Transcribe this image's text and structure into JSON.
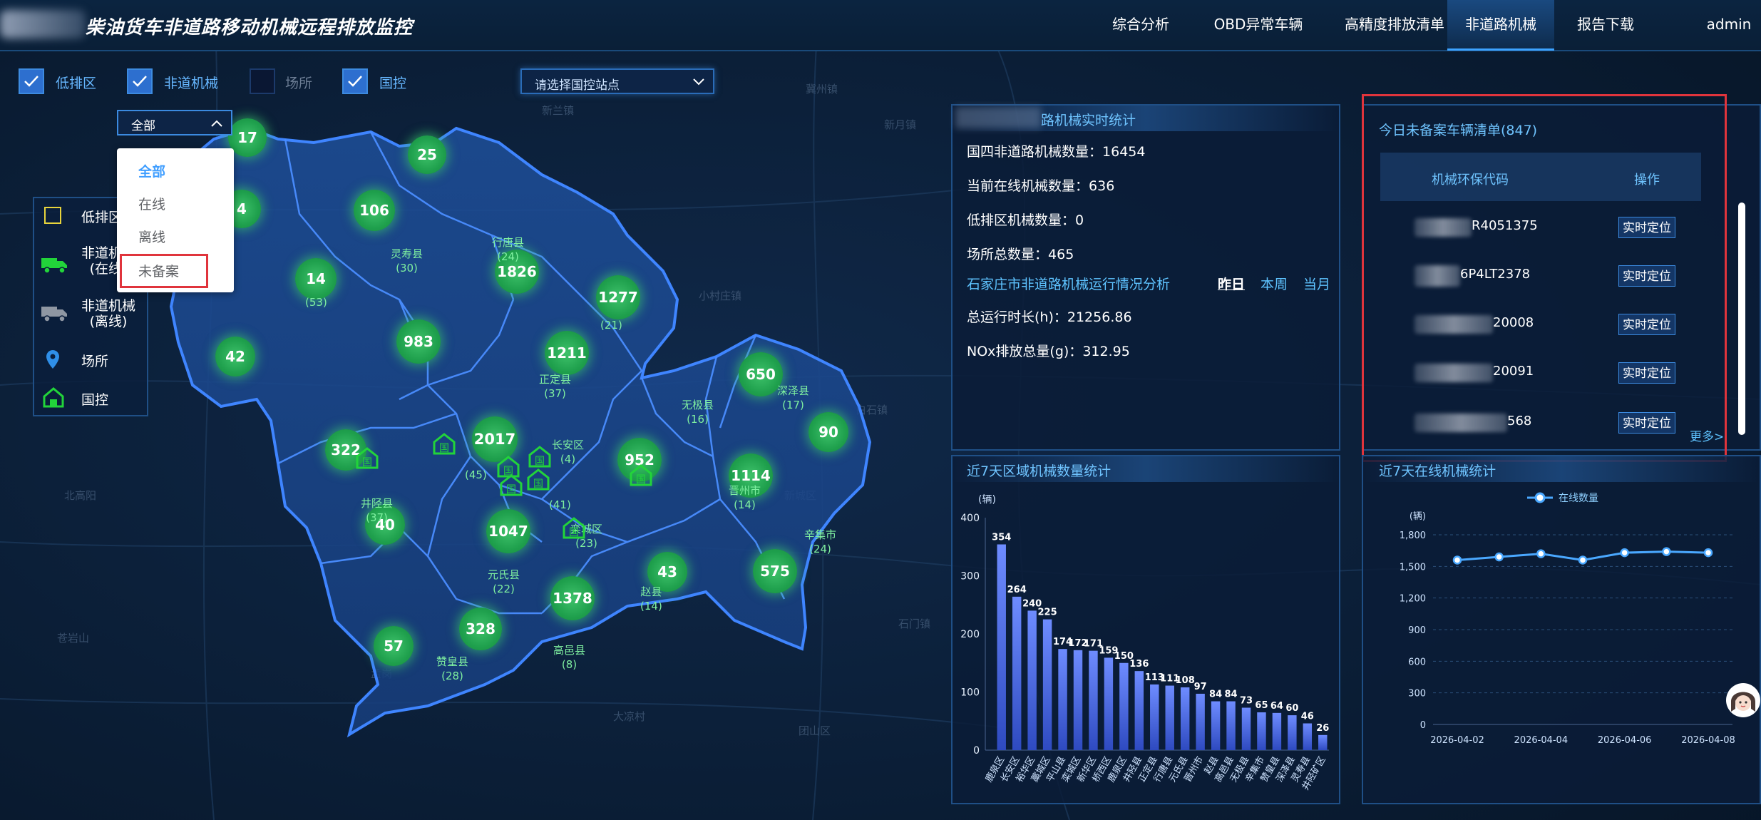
{
  "header": {
    "title": "柴油货车非道路移动机械远程排放监控",
    "tabs": [
      {
        "label": "综合分析",
        "active": false
      },
      {
        "label": "OBD异常车辆",
        "active": false
      },
      {
        "label": "高精度排放清单",
        "active": false
      },
      {
        "label": "非道路机械",
        "active": true
      },
      {
        "label": "报告下载",
        "active": false
      }
    ],
    "user": "admin"
  },
  "layers": [
    {
      "label": "低排区",
      "checked": true
    },
    {
      "label": "非道机械",
      "checked": true
    },
    {
      "label": "场所",
      "checked": false
    },
    {
      "label": "国控",
      "checked": true
    }
  ],
  "site_select": {
    "placeholder": "请选择国控站点"
  },
  "status_filter": {
    "selected": "全部",
    "options": [
      "全部",
      "在线",
      "离线",
      "未备案"
    ],
    "highlighted": "未备案"
  },
  "legend": [
    {
      "label": "低排区",
      "icon": "square-outline-icon"
    },
    {
      "label": "非道机械",
      "sub": "(在线)",
      "icon": "green-truck-icon"
    },
    {
      "label": "非道机械",
      "sub": "(离线)",
      "icon": "gray-truck-icon"
    },
    {
      "label": "场所",
      "icon": "location-pin-icon"
    },
    {
      "label": "国控",
      "icon": "station-icon"
    }
  ],
  "map": {
    "badges": [
      {
        "value": "17"
      },
      {
        "value": "25"
      },
      {
        "value": "4"
      },
      {
        "value": "106"
      },
      {
        "value": "1826"
      },
      {
        "value": "1277"
      },
      {
        "value": "14"
      },
      {
        "value": "983"
      },
      {
        "value": "1211"
      },
      {
        "value": "42"
      },
      {
        "value": "650"
      },
      {
        "value": "90"
      },
      {
        "value": "322"
      },
      {
        "value": "2017"
      },
      {
        "value": "952"
      },
      {
        "value": "1114"
      },
      {
        "value": "40"
      },
      {
        "value": "1047"
      },
      {
        "value": "43"
      },
      {
        "value": "575"
      },
      {
        "value": "1378"
      },
      {
        "value": "328"
      },
      {
        "value": "57"
      }
    ],
    "counties": [
      {
        "name": "灵寿县",
        "count": "(30)"
      },
      {
        "name": "行唐县",
        "count": "(24)"
      },
      {
        "name": "",
        "count": "(21)"
      },
      {
        "name": "正定县",
        "count": "(37)"
      },
      {
        "name": "无极县",
        "count": "(16)"
      },
      {
        "name": "深泽县",
        "count": "(17)"
      },
      {
        "name": "长安区",
        "count": "(4)"
      },
      {
        "name": "井陉县",
        "count": "(37)"
      },
      {
        "name": "元氏县",
        "count": "(22)"
      },
      {
        "name": "赵县",
        "count": "(14)"
      },
      {
        "name": "辛集市",
        "count": "(24)"
      },
      {
        "name": "赞皇县",
        "count": "(28)"
      },
      {
        "name": "高邑县",
        "count": "(8)"
      },
      {
        "name": "栾城区",
        "count": "(23)"
      },
      {
        "name": "晋州市",
        "count": "(14)"
      },
      {
        "name": "",
        "count": "(53)"
      },
      {
        "name": "",
        "count": "(45)"
      },
      {
        "name": "",
        "count": "(41)"
      }
    ],
    "markers": [
      "国",
      "国",
      "国",
      "国",
      "国",
      "国",
      "国",
      "国"
    ]
  },
  "realtime_stats": {
    "title": "路机械实时统计",
    "lines": [
      {
        "label": "国四非道路机械数量：",
        "value": "16454"
      },
      {
        "label": "当前在线机械数量：",
        "value": "636"
      },
      {
        "label": "低排区机械数量：",
        "value": "0"
      },
      {
        "label": "场所总数量：",
        "value": "465"
      }
    ],
    "analysis_title": "石家庄市非道路机械运行情况分析",
    "periods": [
      {
        "label": "昨日",
        "active": true
      },
      {
        "label": "本周",
        "active": false
      },
      {
        "label": "当月",
        "active": false
      }
    ],
    "runtime": {
      "label": "总运行时长(h)：",
      "value": "21256.86"
    },
    "nox": {
      "label": "NOx排放总量(g)：",
      "value": "312.95"
    }
  },
  "unregistered": {
    "title": "今日未备案车辆清单(847)",
    "col_code": "机械环保代码",
    "col_action": "操作",
    "rows": [
      {
        "code": "R4051375",
        "action": "实时定位"
      },
      {
        "code": "6P4LT2378",
        "action": "实时定位"
      },
      {
        "code": "20008",
        "action": "实时定位"
      },
      {
        "code": "20091",
        "action": "实时定位"
      },
      {
        "code": "568",
        "action": "实时定位"
      }
    ],
    "more": "更多>"
  },
  "accent": "#3da3ff",
  "highlight_color": "#e0343c",
  "bar_chart": {
    "title": "近7天区域机械数量统计",
    "unit": "(辆)",
    "chart_data": {
      "type": "bar",
      "ylim": [
        0,
        400
      ],
      "yticks": [
        0,
        100,
        200,
        300,
        400
      ],
      "categories": [
        "鹿泉区",
        "长安区",
        "裕华区",
        "藁城区",
        "平山县",
        "栾城区",
        "新华区",
        "桥西区",
        "鹿泉区",
        "井陉县",
        "正定县",
        "行唐县",
        "元氏县",
        "晋州市",
        "赵县",
        "高邑县",
        "无极县",
        "辛集市",
        "赞皇县",
        "深泽县",
        "灵寿县",
        "井陉矿区"
      ],
      "values": [
        354,
        264,
        240,
        225,
        174,
        172,
        171,
        159,
        150,
        136,
        113,
        111,
        108,
        97,
        84,
        84,
        73,
        65,
        64,
        60,
        46,
        26
      ]
    }
  },
  "line_chart": {
    "title": "近7天在线机械统计",
    "unit": "(辆)",
    "legend": "在线数量",
    "chart_data": {
      "type": "line",
      "ylim": [
        0,
        1800
      ],
      "yticks": [
        "0",
        "300",
        "600",
        "900",
        "1,200",
        "1,500",
        "1,800"
      ],
      "x": [
        "2026-04-02",
        "2026-04-03",
        "2026-04-04",
        "2026-04-05",
        "2026-04-06",
        "2026-04-07",
        "2026-04-08"
      ],
      "xticks": [
        "2026-04-02",
        "2026-04-04",
        "2026-04-06",
        "2026-04-08"
      ],
      "series": [
        {
          "name": "在线数量",
          "values": [
            1560,
            1590,
            1620,
            1560,
            1630,
            1640,
            1630
          ]
        }
      ]
    }
  }
}
